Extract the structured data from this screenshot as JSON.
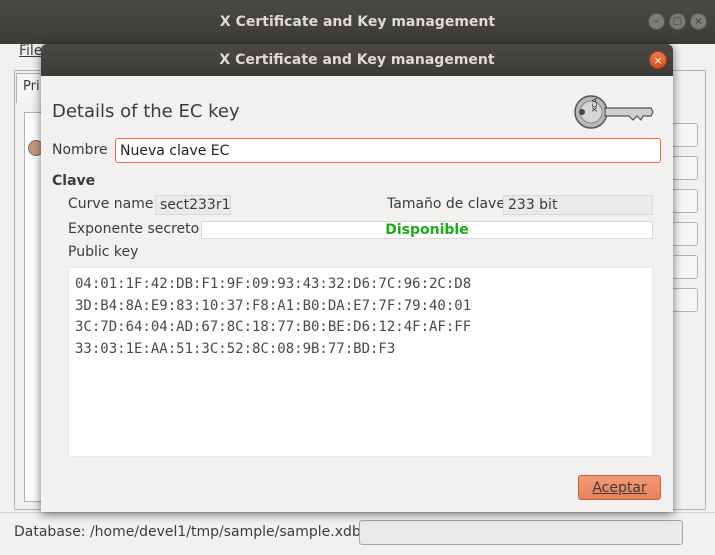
{
  "main_window": {
    "title": "X Certificate and Key management",
    "menu_file": "File",
    "tab_label": "Pri",
    "status_text": "Database: /home/devel1/tmp/sample/sample.xdb",
    "buttons": {
      "minimize": "–",
      "maximize": "□",
      "close": "×"
    }
  },
  "dialog": {
    "title": "X Certificate and Key management",
    "close_glyph": "×",
    "heading": "Details of the EC key",
    "name_label": "Nombre",
    "name_value": "Nueva clave EC",
    "group_title": "Clave",
    "curve_label": "Curve name",
    "curve_value": "sect233r1",
    "keysize_label": "Tamaño de clave",
    "keysize_value": "233 bit",
    "secret_label": "Exponente secreto",
    "secret_value": "Disponible",
    "pubkey_label": "Public key",
    "pubkey_lines": [
      "04:01:1F:42:DB:F1:9F:09:93:43:32:D6:7C:96:2C:D8",
      "3D:B4:8A:E9:83:10:37:F8:A1:B0:DA:E7:7F:79:40:01",
      "3C:7D:64:04:AD:67:8C:18:77:B0:BE:D6:12:4F:AF:FF",
      "33:03:1E:AA:51:3C:52:8C:08:9B:77:BD:F3"
    ],
    "ok_button": "Aceptar",
    "key_icon_text": "XCA"
  },
  "colors": {
    "titlebar": "#3c3b37",
    "accent": "#e8805a",
    "available": "#1aad1a",
    "focus_border": "#e0703a"
  }
}
